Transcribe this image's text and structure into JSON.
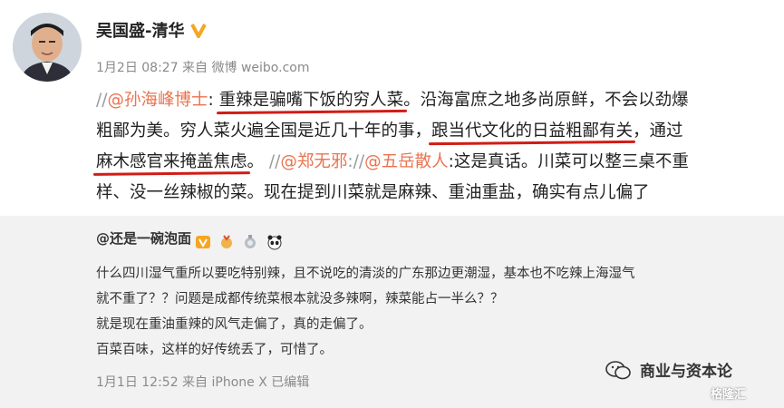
{
  "post": {
    "author": "吴国盛-清华",
    "meta": "1月2日 08:27 来自 微博 weibo.com",
    "line1": {
      "slash": "//",
      "mention": "@孙海峰博士",
      "colon": ": ",
      "underlined": "重辣是骗嘴下饭的穷人菜",
      "rest": "。沿海富庶之地多尚原鲜，不会以劲爆"
    },
    "line2": {
      "pre": "粗鄙为美。穷人菜火遍全国是近几十年的事，",
      "underlined": "跟当代文化的日益粗鄙有关",
      "rest": "，通过"
    },
    "line3": {
      "underlined": "麻木感官来掩盖焦虑",
      "after": "。 ",
      "slash1": "//",
      "mention1": "@郑无邪",
      "colon1": ":",
      "slash2": "//",
      "mention2": "@五岳散人",
      "rest": ":这是真话。川菜可以整三桌不重"
    },
    "line4": "样、没一丝辣椒的菜。现在提到川菜就是麻辣、重油重盐，确实有点儿偏了"
  },
  "repost": {
    "user": "@还是一碗泡面",
    "lines": [
      "什么四川湿气重所以要吃特别辣，且不说吃的清淡的广东那边更潮湿，基本也不吃辣上海湿气",
      "就不重了？？问题是成都传统菜根本就没多辣啊，辣菜能占一半么？？",
      "就是现在重油重辣的风气走偏了，真的走偏了。",
      "百菜百味，这样的好传统丢了，可惜了。"
    ],
    "meta": "1月1日 12:52 来自 iPhone X  已编辑"
  },
  "watermarks": {
    "account": "商业与资本论",
    "logo": "格隆汇"
  },
  "colors": {
    "mention": "#eb7350",
    "underline": "#d11c15",
    "repost_bg": "#f2f2f2",
    "verified": "#f5a623"
  },
  "icons": [
    "verified-badge-icon",
    "vip-badge-icon",
    "medal-icon",
    "level-icon",
    "panda-icon",
    "wechat-icon"
  ]
}
